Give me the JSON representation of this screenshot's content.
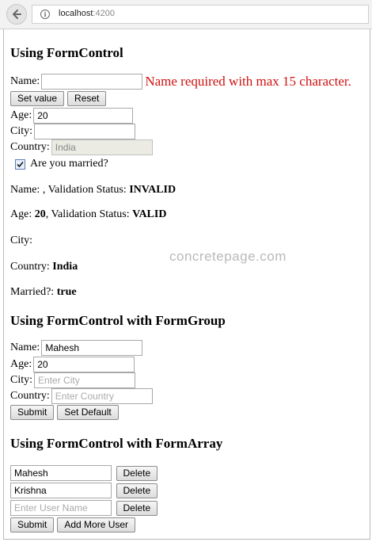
{
  "browser": {
    "url_host": "localhost",
    "url_port": ":4200"
  },
  "section1": {
    "heading": "Using FormControl",
    "name_label": "Name:",
    "name_value": "",
    "name_error": "Name required with max 15 character.",
    "set_value_button": "Set value",
    "reset_button": "Reset",
    "age_label": "Age:",
    "age_value": "20",
    "city_label": "City:",
    "city_value": "",
    "country_label": "Country:",
    "country_value": "India",
    "married_label": "Are you married?",
    "married_checked": true,
    "status_name_prefix": "Name: , Validation Status: ",
    "status_name_value": "INVALID",
    "status_age_prefix": "Age: ",
    "status_age_value": "20",
    "status_age_mid": ", Validation Status: ",
    "status_age_status": "VALID",
    "status_city_label": "City:",
    "status_country_label": "Country: ",
    "status_country_value": "India",
    "status_married_label": "Married?: ",
    "status_married_value": "true"
  },
  "watermark": "concretepage.com",
  "section2": {
    "heading": "Using FormControl with FormGroup",
    "name_label": "Name:",
    "name_value": "Mahesh",
    "age_label": "Age:",
    "age_value": "20",
    "city_label": "City:",
    "city_placeholder": "Enter City",
    "country_label": "Country:",
    "country_placeholder": "Enter Country",
    "submit_button": "Submit",
    "set_default_button": "Set Default"
  },
  "section3": {
    "heading": "Using FormControl with FormArray",
    "users": [
      {
        "value": "Mahesh",
        "delete_label": "Delete"
      },
      {
        "value": "Krishna",
        "delete_label": "Delete"
      },
      {
        "value": "",
        "placeholder": "Enter User Name",
        "delete_label": "Delete"
      }
    ],
    "submit_button": "Submit",
    "add_more_button": "Add More User"
  },
  "colors": {
    "error": "#d01010",
    "watermark": "#b9b9b9"
  },
  "icons": [
    "back-arrow-icon",
    "info-icon",
    "checkbox-checked-icon"
  ]
}
